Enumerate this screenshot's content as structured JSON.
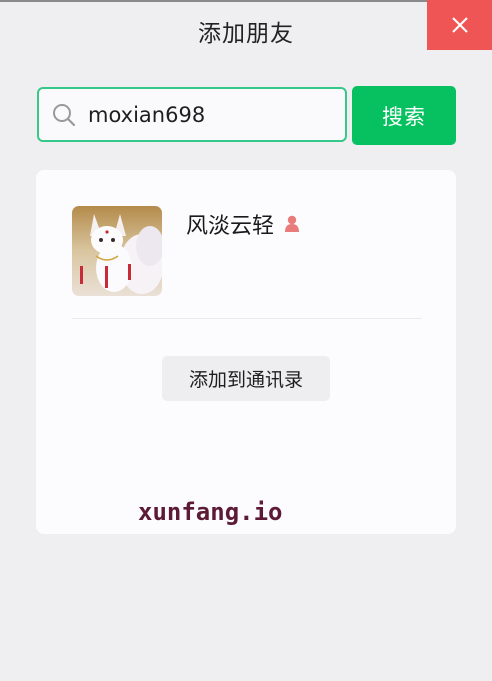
{
  "window": {
    "title": "添加朋友",
    "close_icon": "close-icon",
    "close_color": "#f05555"
  },
  "search": {
    "icon": "search-icon",
    "value": "moxian698",
    "clear_icon": "clear-icon",
    "button_label": "搜索",
    "accent": "#07c160"
  },
  "result": {
    "avatar_desc": "avatar",
    "nickname": "风淡云轻",
    "gender_icon": "female-icon",
    "gender_color": "#e97b7b",
    "add_label": "添加到通讯录"
  },
  "watermark": {
    "text": "xunfang.io"
  }
}
